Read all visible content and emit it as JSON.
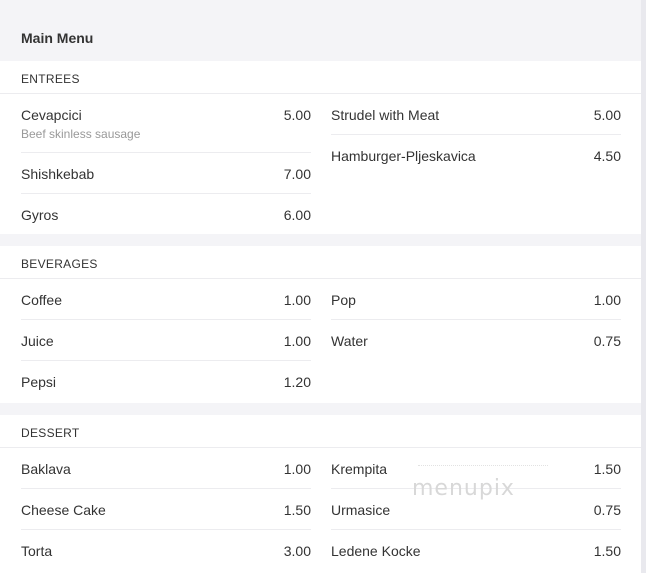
{
  "menu": {
    "title": "Main Menu"
  },
  "sections": [
    {
      "title": "ENTREES",
      "left": [
        {
          "name": "Cevapcici",
          "price": "5.00",
          "desc": "Beef skinless sausage"
        },
        {
          "name": "Shishkebab",
          "price": "7.00"
        },
        {
          "name": "Gyros",
          "price": "6.00"
        }
      ],
      "right": [
        {
          "name": "Strudel with Meat",
          "price": "5.00"
        },
        {
          "name": "Hamburger-Pljeskavica",
          "price": "4.50"
        }
      ]
    },
    {
      "title": "BEVERAGES",
      "left": [
        {
          "name": "Coffee",
          "price": "1.00"
        },
        {
          "name": "Juice",
          "price": "1.00"
        },
        {
          "name": "Pepsi",
          "price": "1.20"
        }
      ],
      "right": [
        {
          "name": "Pop",
          "price": "1.00"
        },
        {
          "name": "Water",
          "price": "0.75"
        }
      ]
    },
    {
      "title": "DESSERT",
      "left": [
        {
          "name": "Baklava",
          "price": "1.00"
        },
        {
          "name": "Cheese Cake",
          "price": "1.50"
        },
        {
          "name": "Torta",
          "price": "3.00"
        }
      ],
      "right": [
        {
          "name": "Krempita",
          "price": "1.50"
        },
        {
          "name": "Urmasice",
          "price": "0.75"
        },
        {
          "name": "Ledene Kocke",
          "price": "1.50"
        }
      ]
    }
  ],
  "watermark": "menupix"
}
